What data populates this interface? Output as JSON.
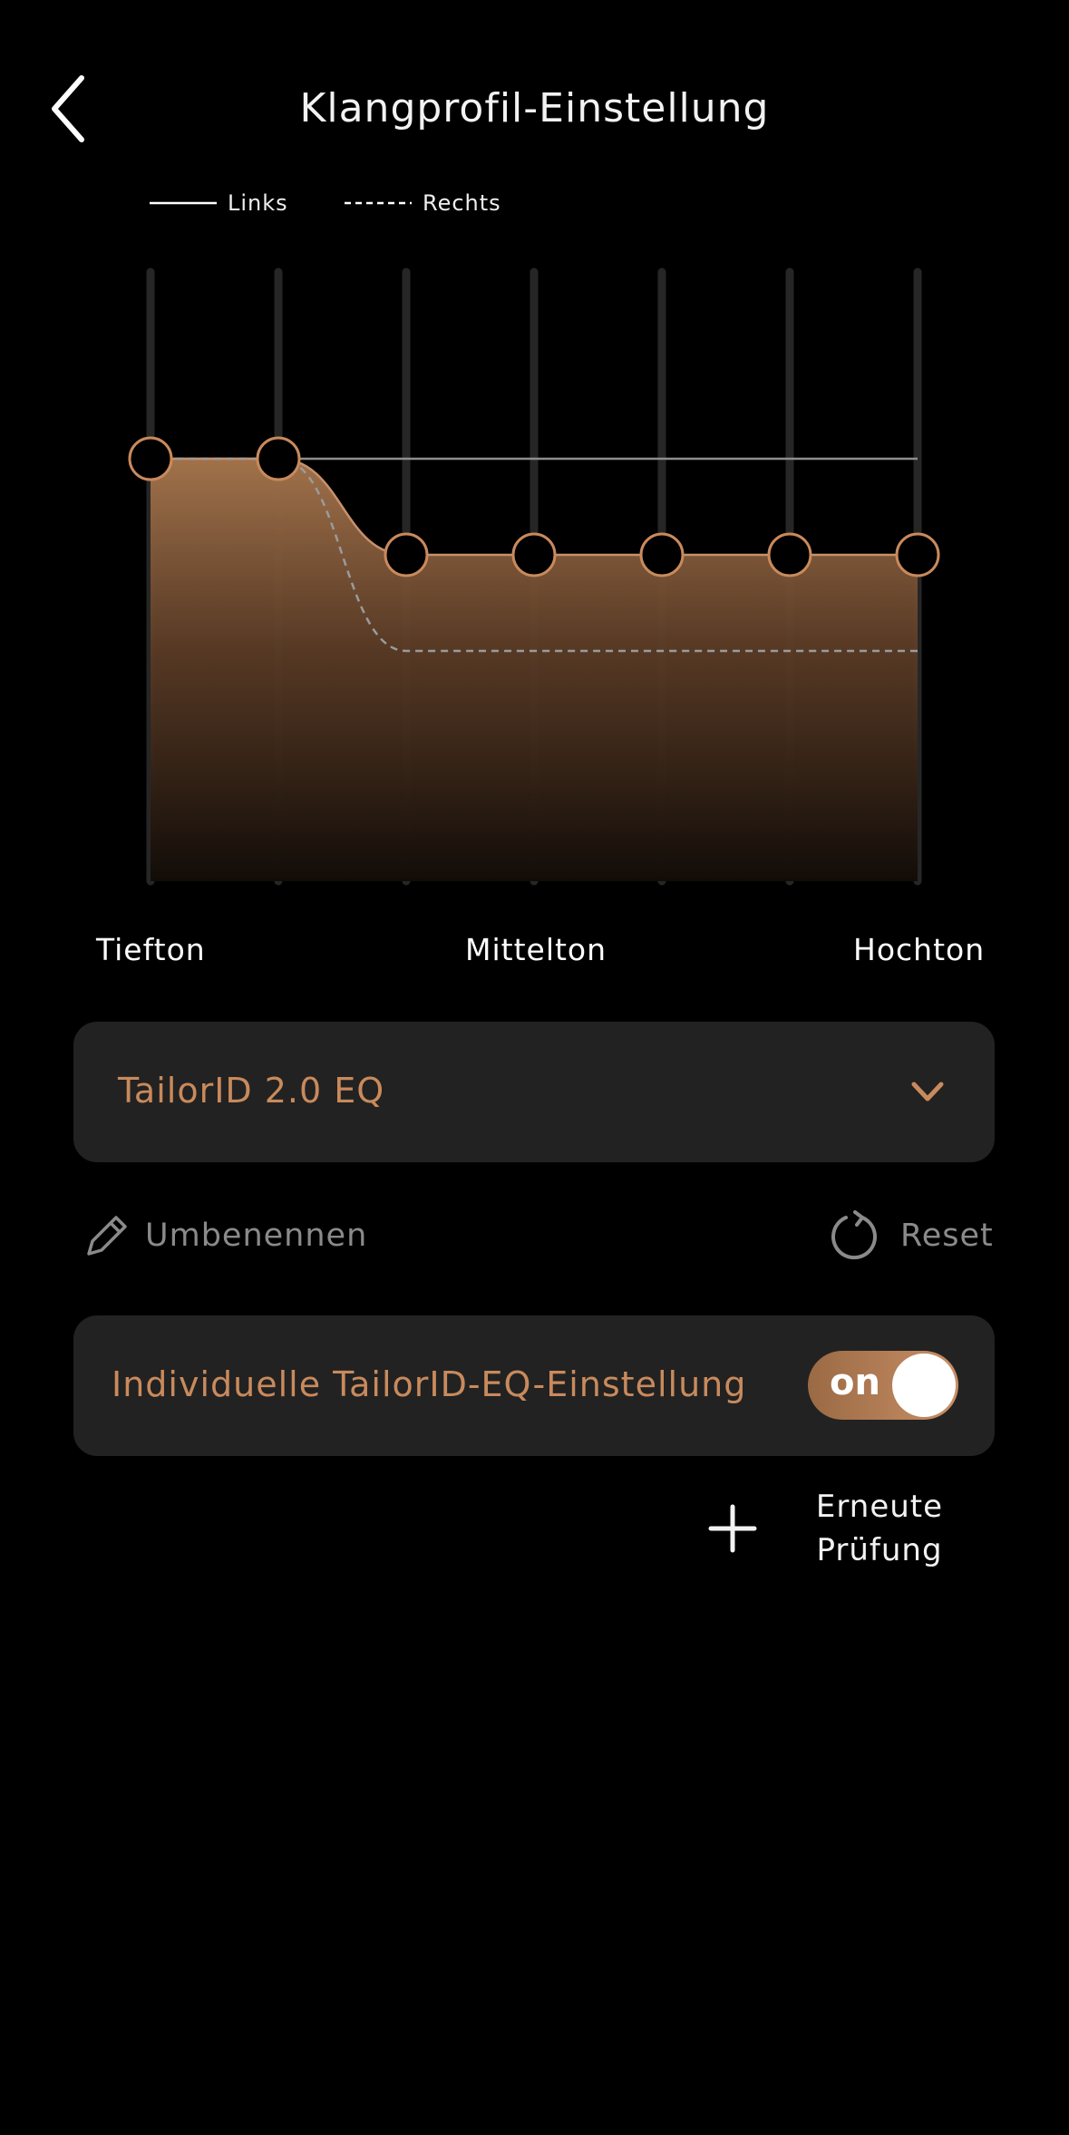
{
  "header": {
    "title": "Klangprofil-Einstellung"
  },
  "legend": {
    "left_label": "Links",
    "right_label": "Rechts"
  },
  "chart_data": {
    "type": "line",
    "bands": 7,
    "series": [
      {
        "name": "Links",
        "style": "solid",
        "values": [
          2,
          2,
          0,
          0,
          0,
          0,
          0
        ]
      },
      {
        "name": "Rechts",
        "style": "dashed",
        "values": [
          2,
          2,
          -2,
          -2,
          -2,
          -2,
          -2
        ]
      }
    ],
    "ylim": [
      -6,
      4
    ],
    "x_axis_labels": [
      "Tiefton",
      "Mittelton",
      "Hochton"
    ]
  },
  "bands": {
    "low": "Tiefton",
    "mid": "Mittelton",
    "high": "Hochton"
  },
  "preset": {
    "label": "TailorID 2.0 EQ"
  },
  "actions": {
    "rename_label": "Umbenennen",
    "reset_label": "Reset"
  },
  "individual": {
    "label": "Individuelle TailorID-EQ-Einstellung",
    "state": "on"
  },
  "retest": {
    "line1": "Erneute",
    "line2": "Prüfung"
  },
  "colors": {
    "accent": "#c98a5c",
    "card": "#222222",
    "background": "#000000"
  }
}
